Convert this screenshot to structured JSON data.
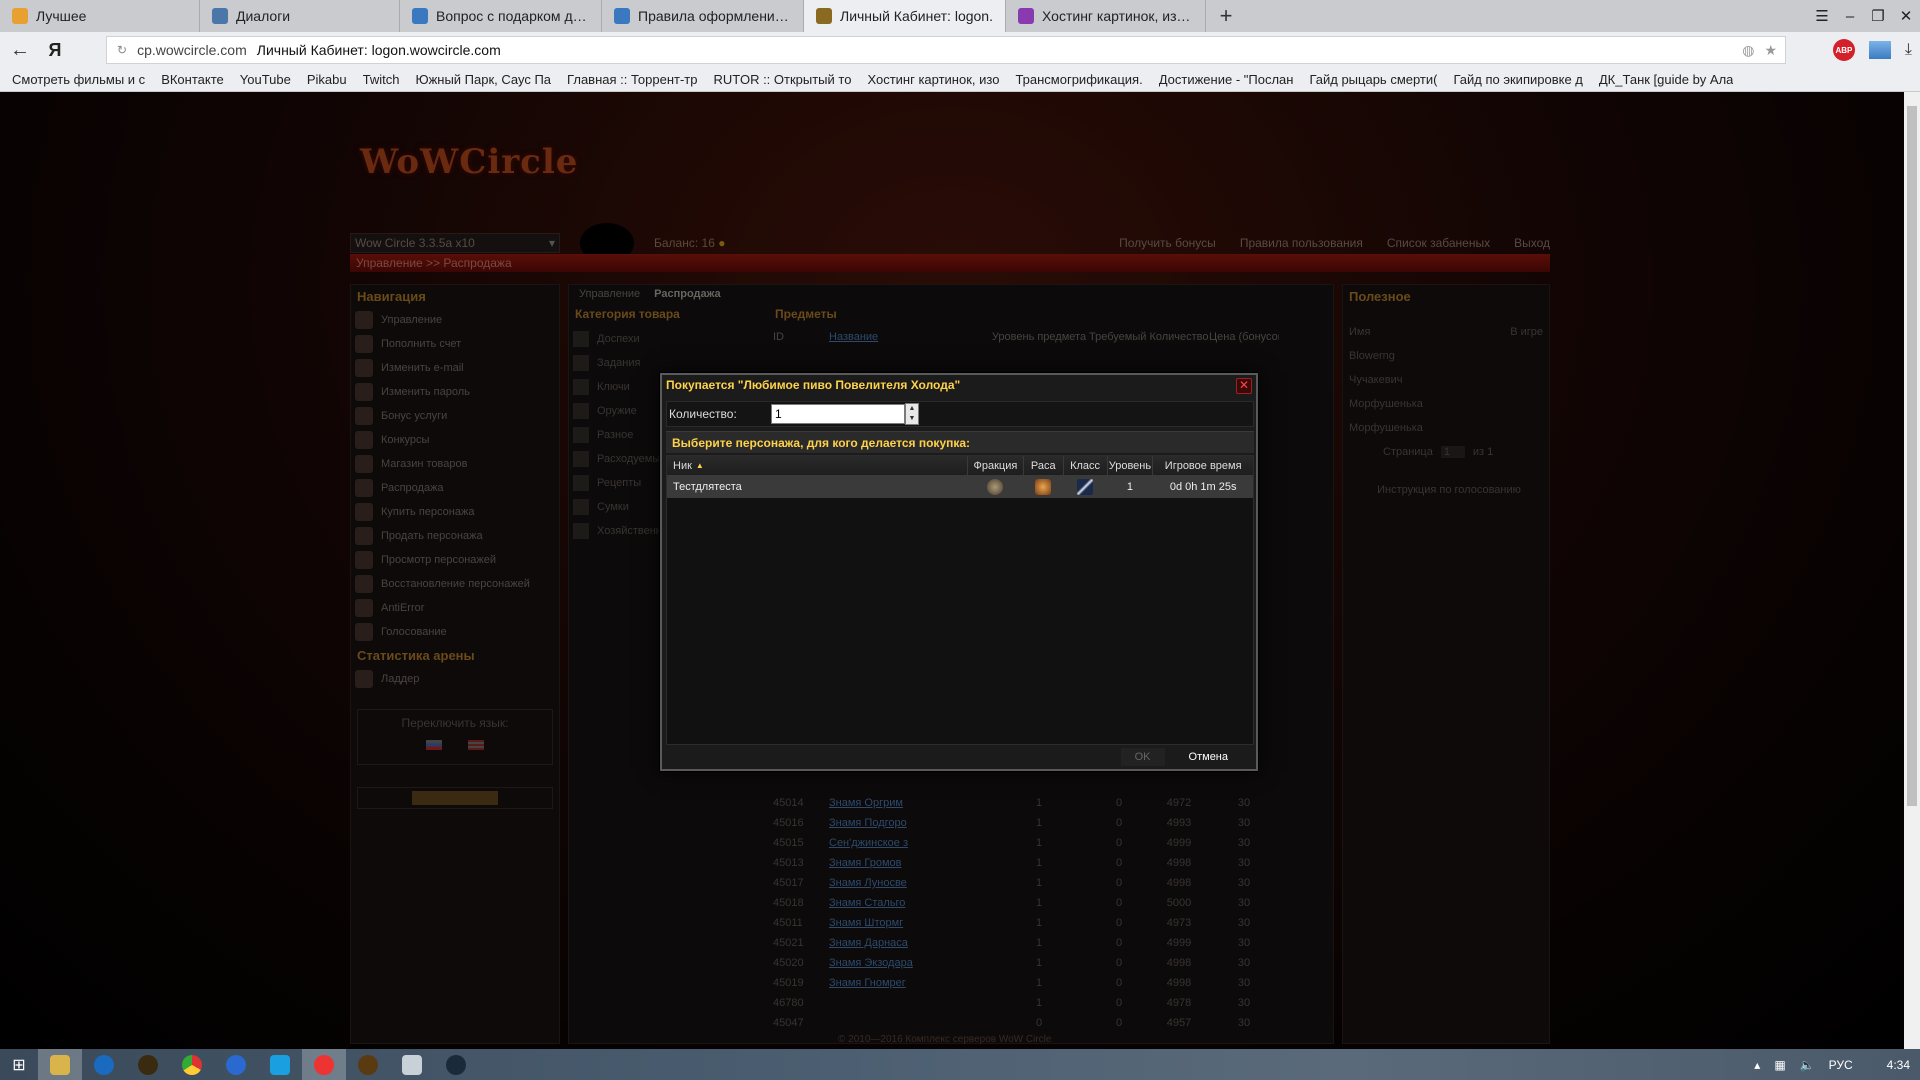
{
  "browser": {
    "tabs": [
      {
        "label": "Лучшее",
        "color": "#e8a030"
      },
      {
        "label": "Диалоги",
        "color": "#4a76a8"
      },
      {
        "label": "Вопрос с подарком другу",
        "color": "#3a78c0"
      },
      {
        "label": "Правила оформления тем",
        "color": "#3a78c0"
      },
      {
        "label": "Личный Кабинет: logon.",
        "color": "#8a6a20"
      },
      {
        "label": "Хостинг картинок, изобр",
        "color": "#8a3ab0"
      }
    ],
    "active_tab": 4,
    "new_tab": "+",
    "url_domain": "cp.wowcircle.com",
    "page_title": "Личный Кабинет: logon.wowcircle.com",
    "bookmarks": [
      "Смотреть фильмы и с",
      "ВКонтакте",
      "YouTube",
      "Pikabu",
      "Twitch",
      "Южный Парк, Саус Па",
      "Главная :: Торрент-тр",
      "RUTOR :: Открытый то",
      "Хостинг картинок, изо",
      "Трансмогрификация.",
      "Достижение - \"Послан",
      "Гайд рыцарь смерти(",
      "Гайд по экипировке д",
      "ДК_Танк [guide by Ала"
    ],
    "abp": "ABP"
  },
  "site": {
    "logo": "WoWCircle",
    "realm": "Wow Circle 3.3.5a x10",
    "balance_label": "Баланс:",
    "balance_value": "16",
    "topnav": [
      "Получить бонусы",
      "Правила пользования",
      "Список забаненых",
      "Выход"
    ],
    "breadcrumb": "Управление >> Распродажа",
    "nav_head": "Навигация",
    "nav_items": [
      "Управление",
      "Пополнить счет",
      "Изменить e-mail",
      "Изменить пароль",
      "Бонус услуги",
      "Конкурсы",
      "Магазин товаров",
      "Распродажа",
      "Купить персонажа",
      "Продать персонажа",
      "Просмотр персонажей",
      "Восстановление персонажей",
      "AntiError",
      "Голосование"
    ],
    "arena_head": "Статистика арены",
    "arena_items": [
      "Ладдер"
    ],
    "lang_head": "Переключить язык:",
    "mid_tabs": [
      "Управление",
      "Распродажа"
    ],
    "category_head": "Категория товара",
    "categories": [
      "Доспехи",
      "Задания",
      "Ключи",
      "Оружие",
      "Разное",
      "Расходуемые",
      "Рецепты",
      "Сумки",
      "Хозяйственные"
    ],
    "items_head": "Предметы",
    "items_columns": [
      "ID",
      "Название",
      "Уровень предмета",
      "Требуемый уровень",
      "Количество",
      "Цена (бонусов)"
    ],
    "items_rows": [
      {
        "id": "45014",
        "name": "Знамя Оргрим",
        "lvl": "1",
        "req": "0",
        "qty": "4972",
        "price": "30"
      },
      {
        "id": "45016",
        "name": "Знамя Подгоро",
        "lvl": "1",
        "req": "0",
        "qty": "4993",
        "price": "30"
      },
      {
        "id": "45015",
        "name": "Сен'джинское з",
        "lvl": "1",
        "req": "0",
        "qty": "4999",
        "price": "30"
      },
      {
        "id": "45013",
        "name": "Знамя Громов",
        "lvl": "1",
        "req": "0",
        "qty": "4998",
        "price": "30"
      },
      {
        "id": "45017",
        "name": "Знамя Луносве",
        "lvl": "1",
        "req": "0",
        "qty": "4998",
        "price": "30"
      },
      {
        "id": "45018",
        "name": "Знамя Стальго",
        "lvl": "1",
        "req": "0",
        "qty": "5000",
        "price": "30"
      },
      {
        "id": "45011",
        "name": "Знамя Штормг",
        "lvl": "1",
        "req": "0",
        "qty": "4973",
        "price": "30"
      },
      {
        "id": "45021",
        "name": "Знамя Дарнаса",
        "lvl": "1",
        "req": "0",
        "qty": "4999",
        "price": "30"
      },
      {
        "id": "45020",
        "name": "Знамя Экзодара",
        "lvl": "1",
        "req": "0",
        "qty": "4998",
        "price": "30"
      },
      {
        "id": "45019",
        "name": "Знамя Гномрег",
        "lvl": "1",
        "req": "0",
        "qty": "4998",
        "price": "30"
      },
      {
        "id": "46780",
        "name": "",
        "lvl": "1",
        "req": "0",
        "qty": "4978",
        "price": "30"
      },
      {
        "id": "45047",
        "name": "",
        "lvl": "0",
        "req": "0",
        "qty": "4957",
        "price": "30"
      }
    ],
    "useful_head": "Полезное",
    "useful_cols": [
      "Имя",
      "В игре"
    ],
    "useful_rows": [
      "Blowerng",
      "Чучакевич",
      "Морфушенька",
      "Морфушенька"
    ],
    "pager_label": "Страница",
    "pager_value": "1",
    "pager_of": "из 1",
    "vote_link": "Инструкция по голосованию",
    "footer": "© 2010—2016 Комплекс серверов WoW Circle"
  },
  "modal": {
    "title": "Покупается \"Любимое пиво Повелителя Холода\"",
    "close": "✕",
    "qty_label": "Количество:",
    "qty_value": "1",
    "choose_head": "Выберите персонажа, для кого делается покупка:",
    "columns": {
      "nick": "Ник",
      "faction": "Фракция",
      "race": "Раса",
      "class": "Класс",
      "level": "Уровень",
      "time": "Игровое время"
    },
    "rows": [
      {
        "nick": "Тестдлятеста",
        "level": "1",
        "time": "0d 0h 1m 25s"
      }
    ],
    "ok": "OK",
    "cancel": "Отмена"
  },
  "taskbar": {
    "lang": "РУС",
    "time": "4:34"
  }
}
